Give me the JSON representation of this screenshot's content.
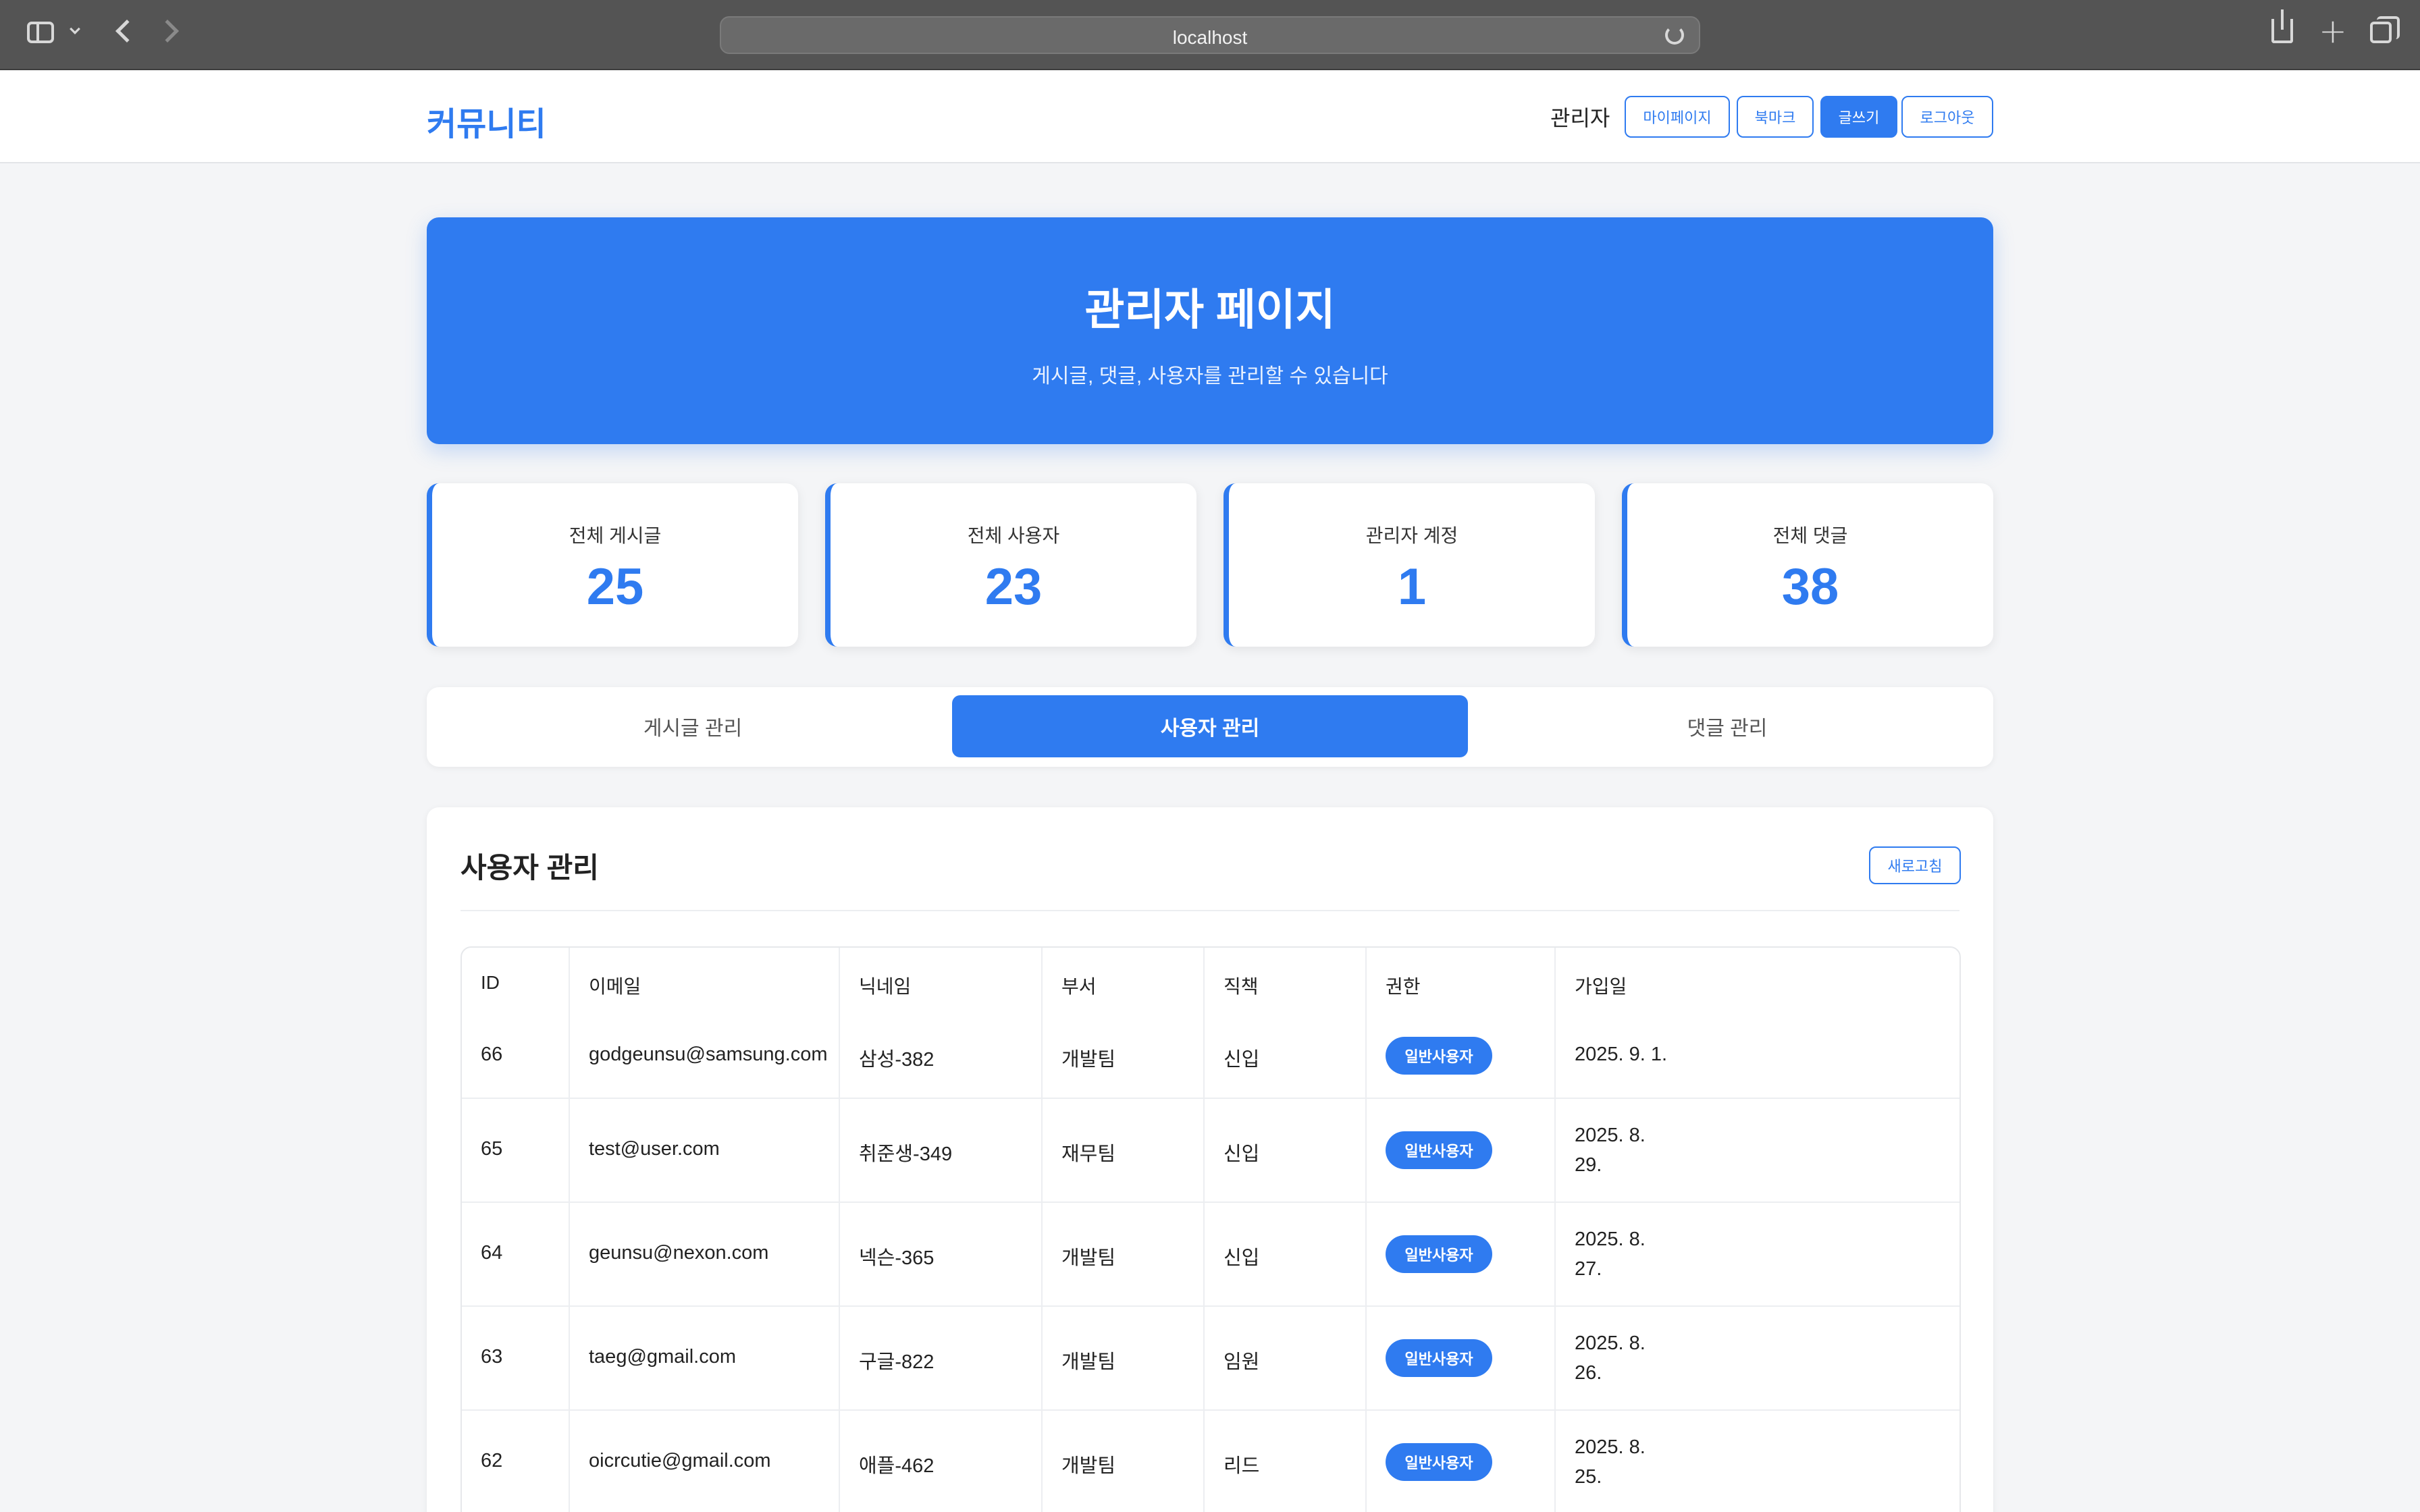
{
  "browser": {
    "url": "localhost"
  },
  "header": {
    "logo": "커뮤니티",
    "user": "관리자",
    "buttons": {
      "mypage": "마이페이지",
      "bookmark": "북마크",
      "write": "글쓰기",
      "logout": "로그아웃"
    }
  },
  "hero": {
    "title": "관리자 페이지",
    "subtitle": "게시글, 댓글, 사용자를 관리할 수 있습니다"
  },
  "stats": [
    {
      "label": "전체 게시글",
      "value": "25"
    },
    {
      "label": "전체 사용자",
      "value": "23"
    },
    {
      "label": "관리자 계정",
      "value": "1"
    },
    {
      "label": "전체 댓글",
      "value": "38"
    }
  ],
  "tabs": [
    {
      "label": "게시글 관리"
    },
    {
      "label": "사용자 관리"
    },
    {
      "label": "댓글 관리"
    }
  ],
  "colors": {
    "accent": "#2f7bf0",
    "background": "#f4f5f7"
  },
  "panel": {
    "title": "사용자 관리",
    "refresh": "새로고침",
    "columns": [
      "ID",
      "이메일",
      "닉네임",
      "부서",
      "직책",
      "권한",
      "가입일"
    ],
    "rows": [
      {
        "id": "66",
        "email": "godgeunsu@samsung.com",
        "nickname": "삼성-382",
        "dept": "개발팀",
        "position": "신입",
        "role": "일반사용자",
        "joined": "2025. 9. 1."
      },
      {
        "id": "65",
        "email": "test@user.com",
        "nickname": "취준생-349",
        "dept": "재무팀",
        "position": "신입",
        "role": "일반사용자",
        "joined": "2025. 8. 29."
      },
      {
        "id": "64",
        "email": "geunsu@nexon.com",
        "nickname": "넥슨-365",
        "dept": "개발팀",
        "position": "신입",
        "role": "일반사용자",
        "joined": "2025. 8. 27."
      },
      {
        "id": "63",
        "email": "taeg@gmail.com",
        "nickname": "구글-822",
        "dept": "개발팀",
        "position": "임원",
        "role": "일반사용자",
        "joined": "2025. 8. 26."
      },
      {
        "id": "62",
        "email": "oicrcutie@gmail.com",
        "nickname": "애플-462",
        "dept": "개발팀",
        "position": "리드",
        "role": "일반사용자",
        "joined": "2025. 8. 25."
      }
    ]
  }
}
